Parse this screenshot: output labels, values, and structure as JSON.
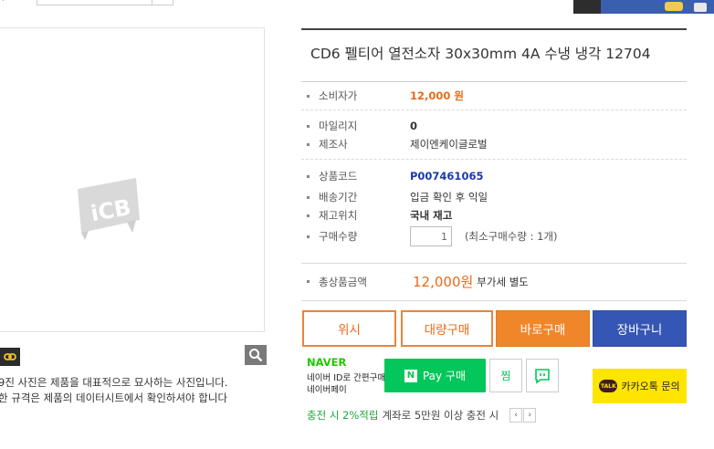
{
  "product": {
    "title": "CD6 펠티어 열전소자 30x30mm 4A 수냉 냉각 12704"
  },
  "gallery": {
    "logo_text": "iCB",
    "notice_line1": "9진 사진은 제품을 대표적으로 묘사하는 사진입니다.",
    "notice_line2": "한 규격은 제품의 데이터시트에서 확인하셔야 합니다"
  },
  "info": {
    "consumer_price_label": "소비자가",
    "consumer_price": "12,000 원",
    "mileage_label": "마일리지",
    "mileage": "0",
    "maker_label": "제조사",
    "maker": "제이엔케이글로벌",
    "code_label": "상품코드",
    "code": "P007461065",
    "delivery_label": "배송기간",
    "delivery": "입금 확인 후 익일",
    "stock_label": "재고위치",
    "stock": "국내 재고",
    "qty_label": "구매수량",
    "qty_value": "1",
    "qty_note": "(최소구매수량 : 1개)",
    "total_label": "총상품금액",
    "total_price": "12,000원",
    "total_vat": "부가세 별도"
  },
  "buttons": {
    "wish": "위시",
    "bulk": "대량구매",
    "buy_now": "바로구매",
    "cart": "장바구니"
  },
  "naver": {
    "brand": "NAVER",
    "line1": "네이버 ID로 간편구매",
    "line2": "네이버페이",
    "pay_n": "N",
    "pay_label": "Pay 구매",
    "wish_label": "찜"
  },
  "kakao": {
    "talk_badge": "TALK",
    "label": "카카오톡 문의"
  },
  "charge": {
    "highlight": "충전 시 2%적립",
    "desc": "계좌로 5만원 이상 충전 시",
    "prev": "‹",
    "next": "›"
  },
  "colors": {
    "accent_orange": "#f0862a",
    "price_orange": "#e96b1a",
    "cart_blue": "#3556b4",
    "naver_green": "#03c75a",
    "kakao_yellow": "#fee500"
  }
}
